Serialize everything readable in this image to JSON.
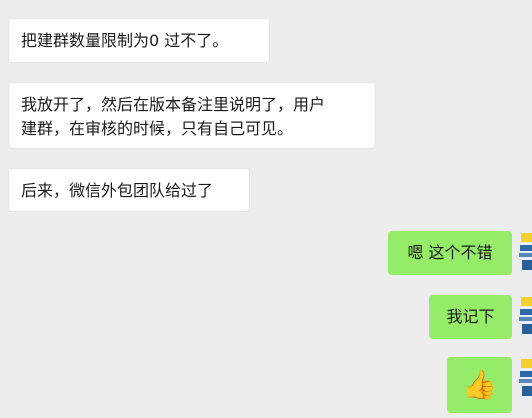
{
  "messages": [
    {
      "text": "把建群数量限制为0  过不了。"
    },
    {
      "line1": "我放开了，然后在版本备注里说明了，用户",
      "line2": "建群，在审核的时候，只有自己可见。"
    },
    {
      "text": "后来，微信外包团队给过了"
    },
    {
      "text": "嗯 这个不错"
    },
    {
      "text": "我记下"
    },
    {
      "emoji": "👍",
      "icon": "thumbs-up"
    }
  ],
  "colors": {
    "background": "#ededed",
    "incoming_bubble": "#ffffff",
    "outgoing_bubble": "#95ec69"
  }
}
